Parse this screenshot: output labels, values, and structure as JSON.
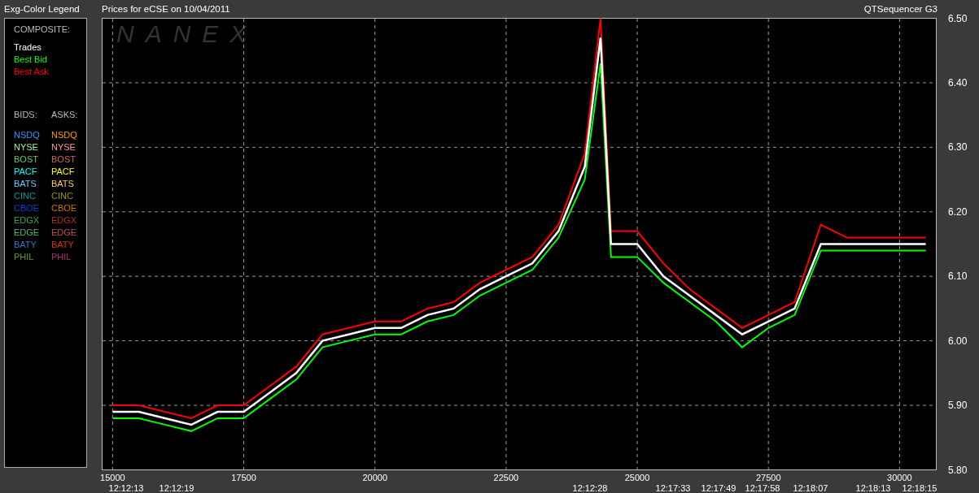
{
  "legend": {
    "title": "Exg-Color Legend",
    "composite_heading": "COMPOSITE:",
    "bids_heading": "BIDS:",
    "asks_heading": "ASKS:",
    "bids": [
      {
        "label": "NSDQ",
        "color": "#3399ff"
      },
      {
        "label": "NYSE",
        "color": "#99ff99"
      },
      {
        "label": "BOST",
        "color": "#66cc66"
      },
      {
        "label": "PACF",
        "color": "#00ffff"
      },
      {
        "label": "BATS",
        "color": "#66ccff"
      },
      {
        "label": "CINC",
        "color": "#009999"
      },
      {
        "label": "CBOE",
        "color": "#0044cc"
      },
      {
        "label": "EDGX",
        "color": "#33aa55"
      },
      {
        "label": "EDGE",
        "color": "#44bb66"
      },
      {
        "label": "BATY",
        "color": "#3377cc"
      },
      {
        "label": "PHIL",
        "color": "#669933"
      }
    ],
    "asks": [
      {
        "label": "NSDQ",
        "color": "#ff9900"
      },
      {
        "label": "NYSE",
        "color": "#ff9999"
      },
      {
        "label": "BOST",
        "color": "#cc6666"
      },
      {
        "label": "PACF",
        "color": "#ffff00"
      },
      {
        "label": "BATS",
        "color": "#ffcc66"
      },
      {
        "label": "CINC",
        "color": "#999900"
      },
      {
        "label": "CBOE",
        "color": "#cc7700"
      },
      {
        "label": "EDGX",
        "color": "#aa3322"
      },
      {
        "label": "EDGE",
        "color": "#bb5544"
      },
      {
        "label": "BATY",
        "color": "#dd3300"
      },
      {
        "label": "PHIL",
        "color": "#aa3366"
      }
    ]
  },
  "chart": {
    "title": "Prices for  eCSE  on 10/04/2011",
    "app_label": "QTSequencer G3",
    "watermark": "NANEX",
    "time_labels": [
      "12:12:13",
      "12:12:19",
      "12:12:28",
      "12:17:33",
      "12:17:49",
      "12:17:58",
      "12:18:07",
      "12:18:13",
      "12:18:15"
    ],
    "chart_data": {
      "type": "line",
      "grid": true,
      "x": [
        15000,
        15500,
        16000,
        16500,
        17000,
        17500,
        18000,
        18500,
        19000,
        19500,
        20000,
        20500,
        21000,
        21500,
        22000,
        22500,
        23000,
        23500,
        24000,
        24300,
        24500,
        25000,
        25500,
        26000,
        26500,
        27000,
        27500,
        28000,
        28500,
        29000,
        29500,
        30000,
        30500
      ],
      "series": [
        {
          "name": "Trades",
          "color": "#ffffff",
          "values": [
            5.89,
            5.89,
            5.88,
            5.87,
            5.89,
            5.89,
            5.92,
            5.95,
            6.0,
            6.01,
            6.02,
            6.02,
            6.04,
            6.05,
            6.08,
            6.1,
            6.12,
            6.17,
            6.27,
            6.47,
            6.15,
            6.15,
            6.1,
            6.07,
            6.04,
            6.01,
            6.03,
            6.05,
            6.15,
            6.15,
            6.15,
            6.15,
            6.15
          ]
        },
        {
          "name": "Best Bid",
          "color": "#00ff00",
          "values": [
            5.88,
            5.88,
            5.87,
            5.86,
            5.88,
            5.88,
            5.91,
            5.94,
            5.99,
            6.0,
            6.01,
            6.01,
            6.03,
            6.04,
            6.07,
            6.09,
            6.11,
            6.16,
            6.25,
            6.43,
            6.13,
            6.13,
            6.09,
            6.06,
            6.03,
            5.99,
            6.02,
            6.04,
            6.14,
            6.14,
            6.14,
            6.14,
            6.14
          ]
        },
        {
          "name": "Best Ask",
          "color": "#ff0000",
          "values": [
            5.9,
            5.9,
            5.89,
            5.88,
            5.9,
            5.9,
            5.93,
            5.96,
            6.01,
            6.02,
            6.03,
            6.03,
            6.05,
            6.06,
            6.09,
            6.11,
            6.13,
            6.18,
            6.29,
            6.5,
            6.17,
            6.17,
            6.12,
            6.08,
            6.05,
            6.02,
            6.04,
            6.06,
            6.18,
            6.16,
            6.16,
            6.16,
            6.16
          ]
        }
      ],
      "xlim": [
        14800,
        30700
      ],
      "ylim": [
        5.8,
        6.5
      ],
      "xticks": [
        15000,
        17500,
        20000,
        22500,
        25000,
        27500,
        30000
      ],
      "yticks": [
        {
          "value": 5.8,
          "label": "5.80"
        },
        {
          "value": 5.9,
          "label": "5.90"
        },
        {
          "value": 6.0,
          "label": "6.00"
        },
        {
          "value": 6.1,
          "label": "6.10"
        },
        {
          "value": 6.2,
          "label": "6.20"
        },
        {
          "value": 6.3,
          "label": "6.30"
        },
        {
          "value": 6.4,
          "label": "6.40"
        },
        {
          "value": 6.5,
          "label": "6.50"
        }
      ]
    }
  }
}
